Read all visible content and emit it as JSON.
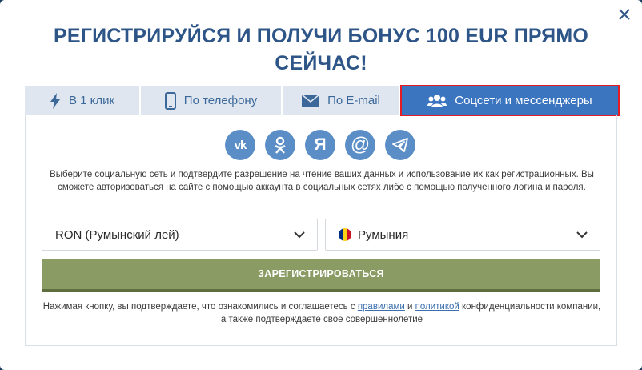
{
  "modal": {
    "title": "РЕГИСТРИРУЙСЯ И ПОЛУЧИ БОНУС 100 EUR ПРЯМО СЕЙЧАС!"
  },
  "tabs": [
    {
      "label": "В 1 клик",
      "icon": "lightning-icon"
    },
    {
      "label": "По телефону",
      "icon": "phone-icon"
    },
    {
      "label": "По E-mail",
      "icon": "envelope-icon"
    },
    {
      "label": "Соцсети и мессенджеры",
      "icon": "users-icon",
      "active": true
    }
  ],
  "socials": [
    {
      "name": "vk",
      "glyph": "vk"
    },
    {
      "name": "odnoklassniki",
      "glyph": "ok"
    },
    {
      "name": "yandex",
      "glyph": "Я"
    },
    {
      "name": "mail",
      "glyph": "@"
    },
    {
      "name": "telegram",
      "glyph": "telegram"
    }
  ],
  "description": "Выберите социальную сеть и подтвердите разрешение на чтение ваших данных и использование их как регистрационных. Вы сможете авторизоваться на сайте с помощью аккаунта в социальных сетях либо с помощью полученного логина и пароля.",
  "currency_select": {
    "value": "RON (Румынский лей)"
  },
  "country_select": {
    "value": "Румыния",
    "flag_colors": [
      "#002b7f",
      "#fcd116",
      "#ce1126"
    ]
  },
  "register_button": {
    "label": "ЗАРЕГИСТРИРОВАТЬСЯ"
  },
  "consent": {
    "part1": "Нажимая кнопку, вы подтверждаете, что ознакомились и соглашаетесь с ",
    "rules_link": "правилами",
    "and": " и ",
    "policy_link": "политикой",
    "part2": " конфиденциальности компании, а также подтверждаете свое совершеннолетие"
  },
  "colors": {
    "title": "#2e5587",
    "tab_bg": "#dfe6ef",
    "tab_active": "#3b75c0",
    "social": "#5b8ec7",
    "register": "#8a9b63",
    "highlight": "#e31b23"
  }
}
